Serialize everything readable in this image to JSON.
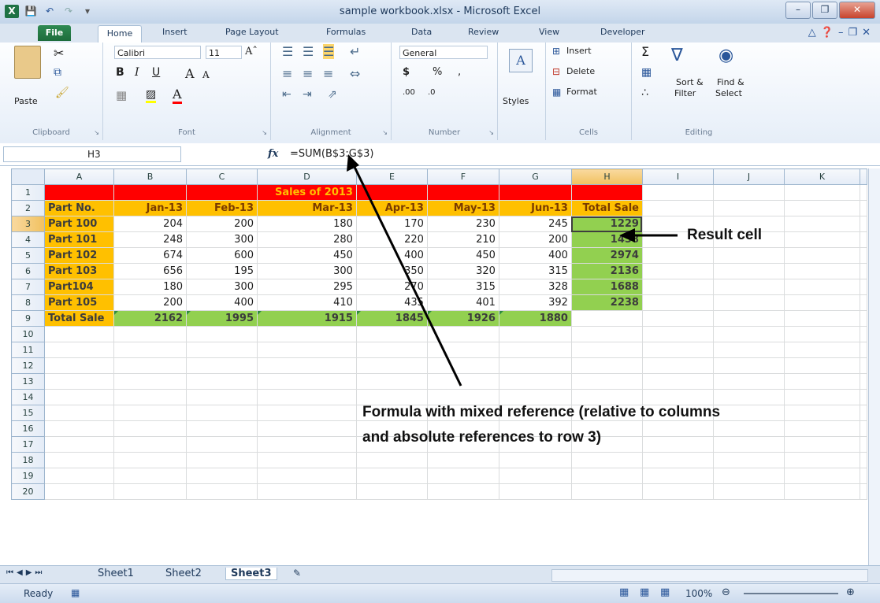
{
  "window": {
    "title": "sample workbook.xlsx - Microsoft Excel"
  },
  "tabs": [
    "File",
    "Home",
    "Insert",
    "Page Layout",
    "Formulas",
    "Data",
    "Review",
    "View",
    "Developer"
  ],
  "ribbon": {
    "clipboard": {
      "label": "Clipboard",
      "paste": "Paste"
    },
    "font": {
      "label": "Font",
      "name": "Calibri",
      "size": "11"
    },
    "alignment": {
      "label": "Alignment"
    },
    "number": {
      "label": "Number",
      "format": "General"
    },
    "styles": {
      "label": "Styles"
    },
    "cells": {
      "label": "Cells",
      "insert": "Insert",
      "delete": "Delete",
      "format": "Format"
    },
    "editing": {
      "label": "Editing",
      "sort": "Sort &",
      "filter": "Filter",
      "find": "Find &",
      "select": "Select"
    }
  },
  "formula_bar": {
    "name_box": "H3",
    "fx": "fx",
    "formula": "=SUM(B$3:G$3)"
  },
  "columns": [
    "A",
    "B",
    "C",
    "D",
    "E",
    "F",
    "G",
    "H",
    "I",
    "J",
    "K"
  ],
  "sheet": {
    "title_row": "Sales of 2013",
    "headers": [
      "Part No.",
      "Jan-13",
      "Feb-13",
      "Mar-13",
      "Apr-13",
      "May-13",
      "Jun-13",
      "Total Sale"
    ],
    "rows": [
      [
        "Part 100",
        "204",
        "200",
        "180",
        "170",
        "230",
        "245",
        "1229"
      ],
      [
        "Part 101",
        "248",
        "300",
        "280",
        "220",
        "210",
        "200",
        "1458"
      ],
      [
        "Part 102",
        "674",
        "600",
        "450",
        "400",
        "450",
        "400",
        "2974"
      ],
      [
        "Part 103",
        "656",
        "195",
        "300",
        "350",
        "320",
        "315",
        "2136"
      ],
      [
        "Part104",
        "180",
        "300",
        "295",
        "270",
        "315",
        "328",
        "1688"
      ],
      [
        "Part 105",
        "200",
        "400",
        "410",
        "435",
        "401",
        "392",
        "2238"
      ]
    ],
    "total_row": [
      "Total Sale",
      "2162",
      "1995",
      "1915",
      "1845",
      "1926",
      "1880"
    ]
  },
  "row_numbers": [
    "1",
    "2",
    "3",
    "4",
    "5",
    "6",
    "7",
    "8",
    "9",
    "10",
    "11",
    "12",
    "13",
    "14",
    "15",
    "16",
    "17",
    "18",
    "19",
    "20"
  ],
  "sheet_tabs": [
    "Sheet1",
    "Sheet2",
    "Sheet3"
  ],
  "status": {
    "ready": "Ready",
    "zoom": "100%"
  },
  "annotations": {
    "result": "Result cell",
    "formula_line1": "Formula with mixed reference (relative to columns",
    "formula_line2": "and absolute references to row 3)"
  }
}
